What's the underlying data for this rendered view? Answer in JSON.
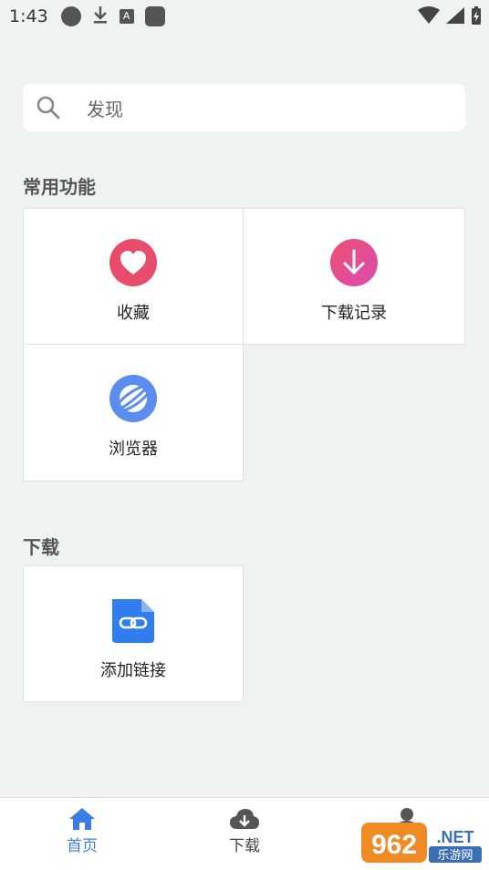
{
  "status_bar": {
    "time": "1:43",
    "notification_a": "A"
  },
  "search": {
    "placeholder": "发现"
  },
  "sections": {
    "common": {
      "title": "常用功能",
      "items": [
        {
          "label": "收藏",
          "icon": "heart-icon",
          "color": "#e94b6a"
        },
        {
          "label": "下载记录",
          "icon": "download-arrow-icon",
          "color": "#e94e9a"
        },
        {
          "label": "浏览器",
          "icon": "planet-icon",
          "color": "#5a8def"
        }
      ]
    },
    "download": {
      "title": "下载",
      "items": [
        {
          "label": "添加链接",
          "icon": "link-file-icon",
          "color": "#2e7ef0"
        }
      ]
    }
  },
  "bottom_nav": {
    "items": [
      {
        "label": "首页",
        "icon": "home-icon",
        "active": true
      },
      {
        "label": "下载",
        "icon": "cloud-download-icon",
        "active": false
      },
      {
        "label": "",
        "icon": "user-icon",
        "active": false
      }
    ]
  },
  "watermark": {
    "text1": "962",
    "text2": ".NET",
    "text3": "乐游网"
  },
  "colors": {
    "accent": "#3b7de2",
    "background": "#eef2f3"
  }
}
